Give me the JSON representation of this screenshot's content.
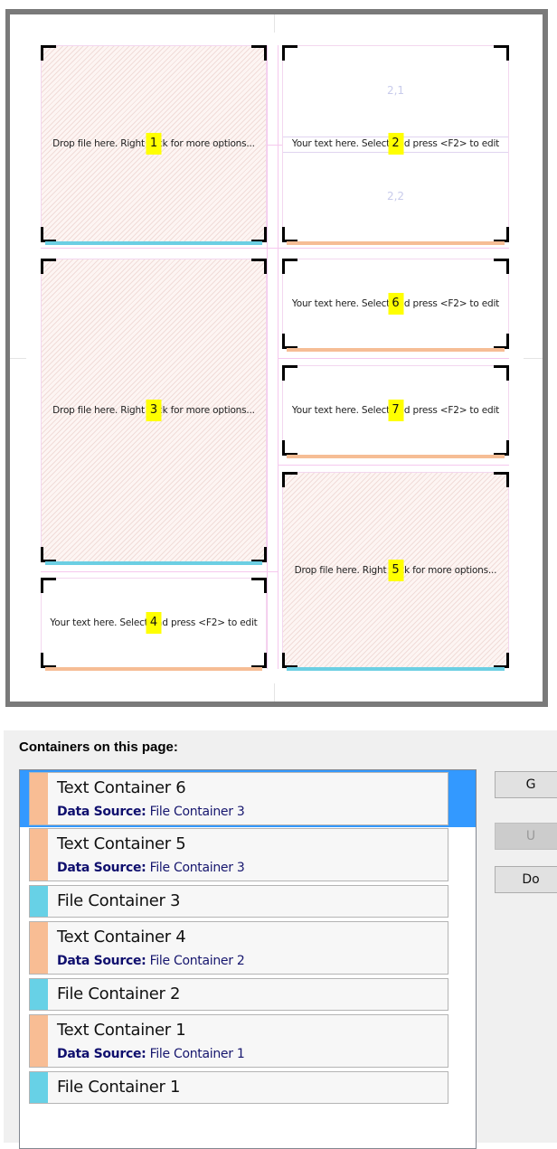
{
  "preview": {
    "boxes": {
      "b1": {
        "number": "1",
        "type": "file",
        "label": "Drop file here. Right click for more options..."
      },
      "b2": {
        "number": "2",
        "type": "text",
        "label": "Your text here. Select and press <F2> to edit",
        "cells": [
          "2,1",
          "2,2"
        ]
      },
      "b3": {
        "number": "3",
        "type": "file",
        "label": "Drop file here. Right click for more options..."
      },
      "b4": {
        "number": "4",
        "type": "text",
        "label": "Your text here. Select and press <F2> to edit"
      },
      "b5": {
        "number": "5",
        "type": "file",
        "label": "Drop file here. Right click for more options..."
      },
      "b6": {
        "number": "6",
        "type": "text",
        "label": "Your text here. Select and press <F2> to edit"
      },
      "b7": {
        "number": "7",
        "type": "text",
        "label": "Your text here. Select and press <F2> to edit"
      }
    },
    "colors": {
      "file_accent": "#6ccfe3",
      "text_accent": "#f6bd95",
      "badge": "#ffff00"
    }
  },
  "panel": {
    "title": "Containers on this page:",
    "data_source_label": "Data Source:",
    "items": [
      {
        "title": "Text Container 6",
        "kind": "text",
        "source": "File Container 3",
        "selected": true
      },
      {
        "title": "Text Container 5",
        "kind": "text",
        "source": "File Container 3",
        "selected": false
      },
      {
        "title": "File Container 3",
        "kind": "file",
        "source": null,
        "selected": false
      },
      {
        "title": "Text Container 4",
        "kind": "text",
        "source": "File Container 2",
        "selected": false
      },
      {
        "title": "File Container 2",
        "kind": "file",
        "source": null,
        "selected": false
      },
      {
        "title": "Text Container 1",
        "kind": "text",
        "source": "File Container 1",
        "selected": false
      },
      {
        "title": "File Container 1",
        "kind": "file",
        "source": null,
        "selected": false
      }
    ],
    "buttons": [
      {
        "label": "G",
        "enabled": true
      },
      {
        "label": "U",
        "enabled": false
      },
      {
        "label": "Do",
        "enabled": true
      }
    ],
    "colors": {
      "selection": "#3399ff",
      "text_swatch": "#f8bd94",
      "file_swatch": "#67d1e6"
    }
  }
}
